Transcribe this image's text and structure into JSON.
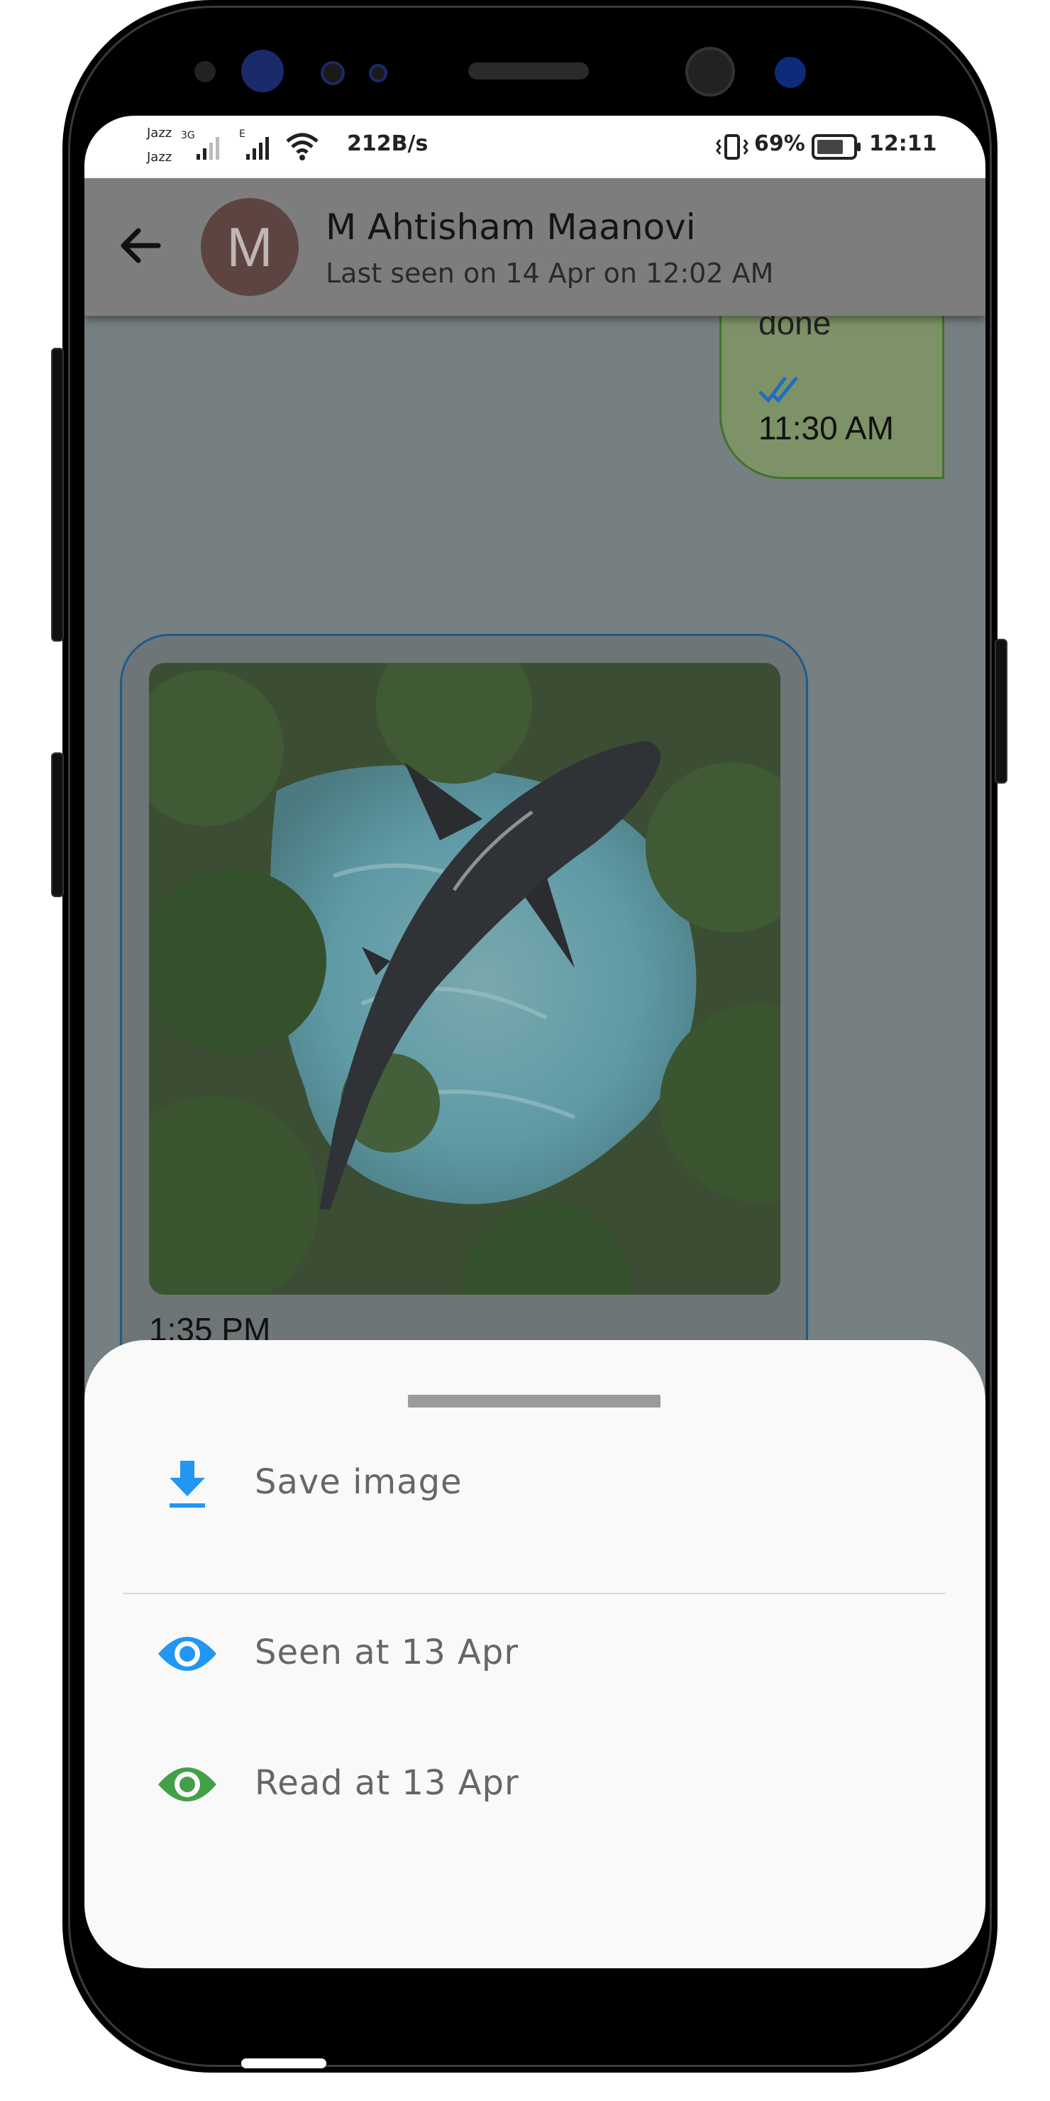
{
  "status_bar": {
    "carrier_1": "Jazz",
    "carrier_2": "Jazz",
    "network_type_1": "3G",
    "network_type_2": "E",
    "speed": "212B/s",
    "battery_percent": "69%",
    "time": "12:11"
  },
  "header": {
    "avatar_letter": "M",
    "contact_name": "M Ahtisham Maanovi",
    "last_seen": "Last seen on 14 Apr on 12:02 AM"
  },
  "messages": [
    {
      "type": "text",
      "direction": "sent",
      "text_fragment": "done",
      "time": "11:30 AM"
    },
    {
      "type": "image",
      "direction": "received",
      "time": "1:35 PM"
    }
  ],
  "bottom_sheet": {
    "items": [
      {
        "label": "Save image",
        "icon": "download-icon"
      },
      {
        "label": "Seen at  13 Apr",
        "icon": "eye-icon"
      },
      {
        "label": "Read at  13 Apr",
        "icon": "eye-icon"
      }
    ]
  },
  "colors": {
    "accent_blue": "#2196f3",
    "accent_green": "#43a047",
    "sent_bubble": "#7e9268",
    "received_border": "#1f5a8a"
  }
}
